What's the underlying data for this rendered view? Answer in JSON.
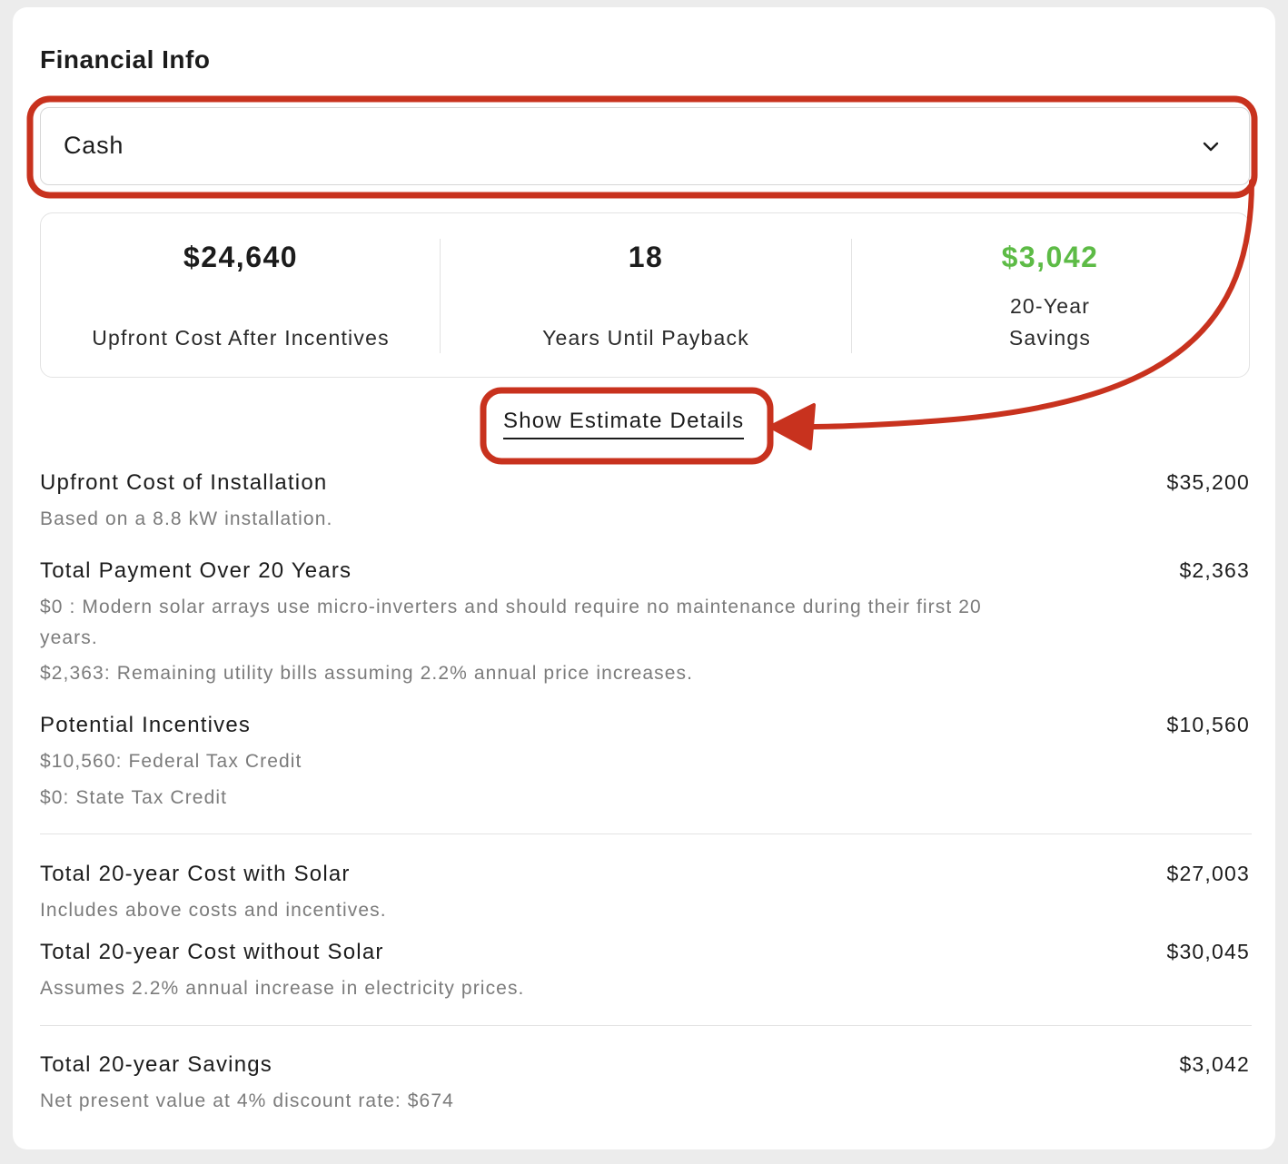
{
  "header": {
    "title": "Financial Info"
  },
  "finance_select": {
    "value": "Cash"
  },
  "summary": {
    "upfront": {
      "value": "$24,640",
      "label": "Upfront Cost After Incentives"
    },
    "payback": {
      "value": "18",
      "label": "Years Until Payback"
    },
    "savings": {
      "value": "$3,042",
      "label_line1": "20-Year",
      "label_line2": "Savings",
      "color": "#5dbb46"
    }
  },
  "toggle": {
    "label": "Show Estimate Details"
  },
  "details": {
    "installation": {
      "title": "Upfront Cost of Installation",
      "amount": "$35,200",
      "note": "Based on a 8.8 kW installation."
    },
    "payment": {
      "title": "Total Payment Over 20 Years",
      "amount": "$2,363",
      "note1": "$0 : Modern solar arrays use micro-inverters and should require no maintenance during their first 20",
      "note1b": "years.",
      "note2": "$2,363: Remaining utility bills assuming 2.2% annual price increases."
    },
    "incentives": {
      "title": "Potential Incentives",
      "amount": "$10,560",
      "note1": "$10,560: Federal Tax Credit",
      "note2": "$0: State Tax Credit"
    },
    "with_solar": {
      "title": "Total 20-year Cost with Solar",
      "amount": "$27,003",
      "note": "Includes above costs and incentives."
    },
    "without_solar": {
      "title": "Total 20-year Cost without Solar",
      "amount": "$30,045",
      "note": "Assumes 2.2% annual increase in electricity prices."
    },
    "savings": {
      "title": "Total 20-year Savings",
      "amount": "$3,042",
      "note": "Net present value at 4% discount rate: $674"
    }
  },
  "annotation": {
    "color": "#c8321e"
  }
}
